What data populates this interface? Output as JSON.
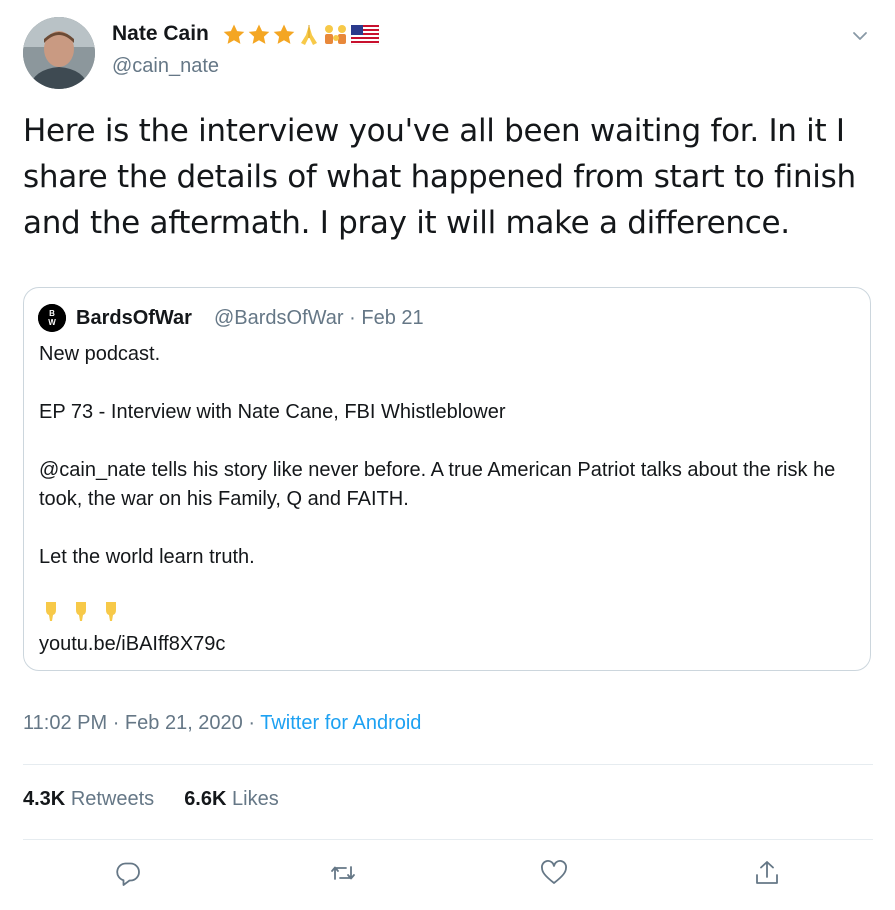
{
  "author": {
    "name": "Nate Cain",
    "handle": "@cain_nate",
    "badges": [
      "star-icon",
      "star-icon",
      "star-icon",
      "praying-hands-icon",
      "family-icon",
      "us-flag-icon"
    ]
  },
  "tweet": {
    "text": "Here is the interview you've all been waiting for. In it I share the details of what happened from start to finish and the aftermath. I pray it will make a difference."
  },
  "quoted": {
    "name": "BardsOfWar",
    "handle": "@BardsOfWar",
    "separator": "·",
    "date": "Feb 21",
    "lines": [
      "New podcast.",
      "EP 73 - Interview with Nate Cane, FBI Whistleblower",
      "@cain_nate tells his story like never before. A true American Patriot talks about the risk he took, the war on his Family, Q and FAITH.",
      "Let the world learn truth."
    ],
    "link": "youtu.be/iBAIff8X79c"
  },
  "meta": {
    "time": "11:02 PM",
    "date": "Feb 21, 2020",
    "separator": "·",
    "source": "Twitter for Android"
  },
  "stats": {
    "retweets_count": "4.3K",
    "retweets_label": "Retweets",
    "likes_count": "6.6K",
    "likes_label": "Likes"
  },
  "colors": {
    "accent": "#1da1f2",
    "muted": "#657786",
    "border": "#ccd6dd",
    "text": "#14171a"
  }
}
